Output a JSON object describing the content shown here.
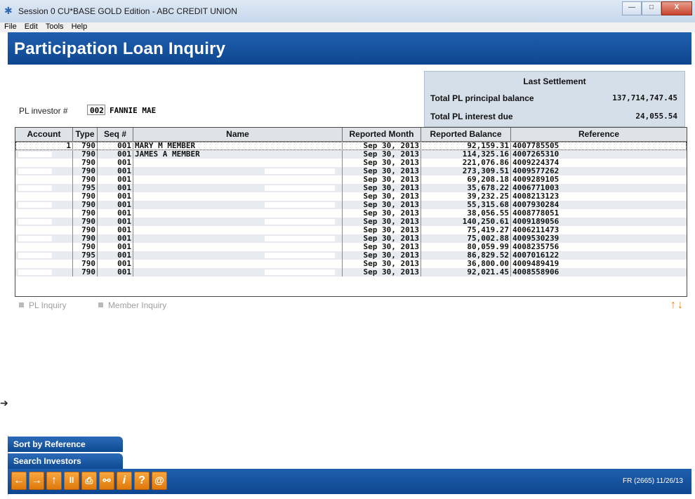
{
  "window": {
    "title": "Session 0 CU*BASE GOLD Edition - ABC CREDIT UNION",
    "controls": [
      "—",
      "□",
      "X"
    ]
  },
  "menu": [
    "File",
    "Edit",
    "Tools",
    "Help"
  ],
  "page": {
    "title": "Participation Loan Inquiry"
  },
  "investor": {
    "label": "PL investor #",
    "code": "002",
    "name": "FANNIE MAE"
  },
  "settlement": {
    "title": "Last Settlement",
    "principal_label": "Total PL principal balance",
    "principal_value": "137,714,747.45",
    "interest_label": "Total PL interest due",
    "interest_value": "24,055.54"
  },
  "table": {
    "columns": [
      "Account",
      "Type",
      "Seq #",
      "Name",
      "Reported Month",
      "Reported Balance",
      "Reference"
    ],
    "rows": [
      {
        "account": "1",
        "type": "790",
        "seq": "001",
        "name": "MARY M MEMBER",
        "month": "Sep 30, 2013",
        "balance": "92,159.31",
        "ref": "4007785505"
      },
      {
        "account": "",
        "type": "790",
        "seq": "001",
        "name": "JAMES A MEMBER",
        "month": "Sep 30, 2013",
        "balance": "114,325.16",
        "ref": "4007265310"
      },
      {
        "account": "",
        "type": "790",
        "seq": "001",
        "name": "",
        "month": "Sep 30, 2013",
        "balance": "221,076.86",
        "ref": "4009224374"
      },
      {
        "account": "",
        "type": "790",
        "seq": "001",
        "name": "",
        "month": "Sep 30, 2013",
        "balance": "273,309.51",
        "ref": "4009577262"
      },
      {
        "account": "",
        "type": "790",
        "seq": "001",
        "name": "",
        "month": "Sep 30, 2013",
        "balance": "69,208.18",
        "ref": "4009289105"
      },
      {
        "account": "",
        "type": "795",
        "seq": "001",
        "name": "",
        "month": "Sep 30, 2013",
        "balance": "35,678.22",
        "ref": "4006771003"
      },
      {
        "account": "",
        "type": "790",
        "seq": "001",
        "name": "",
        "month": "Sep 30, 2013",
        "balance": "39,232.25",
        "ref": "4008213123"
      },
      {
        "account": "",
        "type": "790",
        "seq": "001",
        "name": "",
        "month": "Sep 30, 2013",
        "balance": "55,315.68",
        "ref": "4007930284"
      },
      {
        "account": "",
        "type": "790",
        "seq": "001",
        "name": "",
        "month": "Sep 30, 2013",
        "balance": "38,056.55",
        "ref": "4008778051"
      },
      {
        "account": "",
        "type": "790",
        "seq": "001",
        "name": "",
        "month": "Sep 30, 2013",
        "balance": "140,250.61",
        "ref": "4009189056"
      },
      {
        "account": "",
        "type": "790",
        "seq": "001",
        "name": "",
        "month": "Sep 30, 2013",
        "balance": "75,419.27",
        "ref": "4006211473"
      },
      {
        "account": "",
        "type": "790",
        "seq": "001",
        "name": "",
        "month": "Sep 30, 2013",
        "balance": "75,002.88",
        "ref": "4009530239"
      },
      {
        "account": "",
        "type": "790",
        "seq": "001",
        "name": "",
        "month": "Sep 30, 2013",
        "balance": "80,059.99",
        "ref": "4008235756"
      },
      {
        "account": "",
        "type": "795",
        "seq": "001",
        "name": "",
        "month": "Sep 30, 2013",
        "balance": "86,829.52",
        "ref": "4007016122"
      },
      {
        "account": "",
        "type": "790",
        "seq": "001",
        "name": "",
        "month": "Sep 30, 2013",
        "balance": "36,800.00",
        "ref": "4009489419"
      },
      {
        "account": "",
        "type": "790",
        "seq": "001",
        "name": "",
        "month": "Sep 30, 2013",
        "balance": "92,021.45",
        "ref": "4008558906"
      }
    ]
  },
  "options": {
    "pl_inquiry": "PL Inquiry",
    "member_inquiry": "Member Inquiry"
  },
  "scroll": {
    "up": "↑",
    "down": "↓"
  },
  "side_buttons": {
    "sort_by_reference": "Sort by Reference",
    "search_investors": "Search Investors"
  },
  "toolbar": {
    "icons": [
      "back-arrow-icon",
      "forward-arrow-icon",
      "up-arrow-icon",
      "pause-icon",
      "print-icon",
      "link-icon",
      "info-icon",
      "help-icon",
      "email-icon"
    ],
    "glyphs": [
      "←",
      "→",
      "↑",
      "II",
      "⎙",
      "⚯",
      "i",
      "?",
      "@"
    ]
  },
  "footer_info": "FR (2665) 11/26/13",
  "colors": {
    "header_blue": "#1f5fae",
    "accent_orange": "#e8800e",
    "settlement_bg": "#d5dfea"
  }
}
